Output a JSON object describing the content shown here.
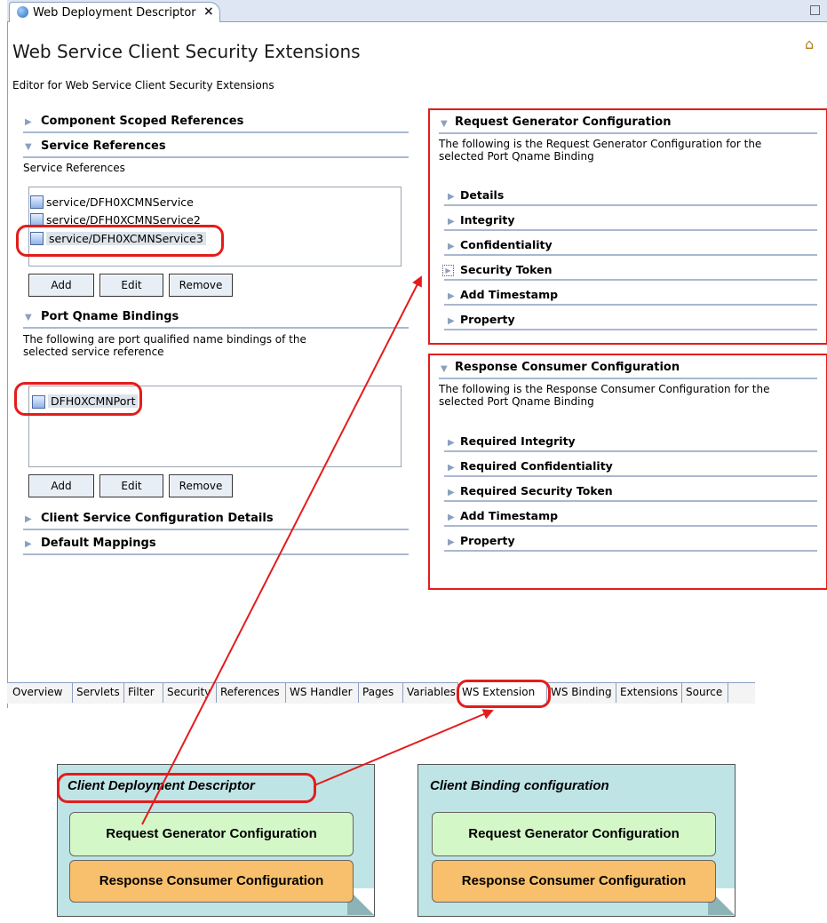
{
  "editor": {
    "tab_label": "Web Deployment Descriptor",
    "tab_close": "×",
    "title": "Web Service Client Security Extensions",
    "subtitle": "Editor for Web Service Client Security Extensions"
  },
  "left": {
    "component_scoped": "Component Scoped References",
    "service_refs": {
      "heading": "Service References",
      "label": "Service References",
      "items": [
        "service/DFH0XCMNService",
        "service/DFH0XCMNService2",
        "service/DFH0XCMNService3"
      ],
      "buttons": [
        "Add",
        "Edit",
        "Remove"
      ]
    },
    "port_bindings": {
      "heading": "Port Qname Bindings",
      "description": "The following are port qualified name bindings of the selected service reference",
      "items": [
        "DFH0XCMNPort"
      ],
      "buttons": [
        "Add",
        "Edit",
        "Remove"
      ]
    },
    "client_service": "Client Service Configuration Details",
    "default_mappings": "Default Mappings"
  },
  "request_gen": {
    "heading": "Request Generator Configuration",
    "description": "The following is the Request Generator Configuration for the selected Port Qname Binding",
    "items": [
      "Details",
      "Integrity",
      "Confidentiality",
      "Security Token",
      "Add Timestamp",
      "Property"
    ]
  },
  "response_cons": {
    "heading": "Response Consumer Configuration",
    "description": "The following is the Response Consumer Configuration for the selected Port Qname Binding",
    "items": [
      "Required Integrity",
      "Required Confidentiality",
      "Required Security Token",
      "Add Timestamp",
      "Property"
    ]
  },
  "bottom_tabs": [
    "Overview",
    "Servlets",
    "Filter",
    "Security",
    "References",
    "WS Handler",
    "Pages",
    "Variables",
    "WS Extension",
    "WS Binding",
    "Extensions",
    "Source"
  ],
  "diagram": {
    "left_note": {
      "title": "Client Deployment Descriptor",
      "box1": "Request Generator Configuration",
      "box2": "Response Consumer Configuration"
    },
    "right_note": {
      "title": "Client Binding configuration",
      "box1": "Request Generator Configuration",
      "box2": "Response Consumer Configuration"
    }
  },
  "colors": {
    "highlight": "#e41c1c",
    "note": "#bfe4e6",
    "green_box": "#d4f7c8",
    "orange_box": "#f8c06c"
  }
}
